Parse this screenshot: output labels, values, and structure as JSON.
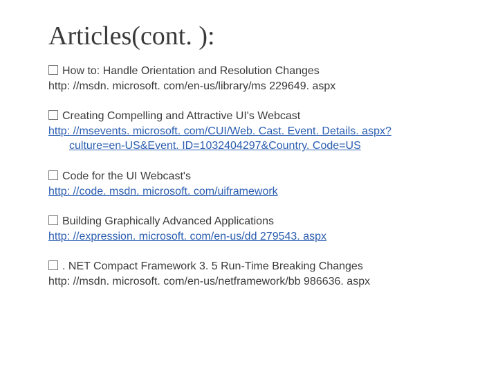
{
  "title": "Articles(cont. ):",
  "items": [
    {
      "heading": "How to: Handle Orientation and Resolution Changes",
      "url": "http: //msdn. microsoft. com/en-us/library/ms 229649. aspx",
      "url_cont": "",
      "is_link": false
    },
    {
      "heading": "Creating Compelling and Attractive UI's Webcast",
      "url": "http: //msevents. microsoft. com/CUI/Web. Cast. Event. Details. aspx?",
      "url_cont": "culture=en-US&Event. ID=1032404297&Country. Code=US",
      "is_link": true
    },
    {
      "heading": "Code for the UI Webcast's",
      "url": "http: //code. msdn. microsoft. com/uiframework",
      "url_cont": "",
      "is_link": true
    },
    {
      "heading": "Building Graphically Advanced Applications",
      "url": "http: //expression. microsoft. com/en-us/dd 279543. aspx",
      "url_cont": "",
      "is_link": true
    },
    {
      "heading": ". NET Compact Framework 3. 5 Run-Time Breaking Changes",
      "url": "http: //msdn. microsoft. com/en-us/netframework/bb 986636. aspx",
      "url_cont": "",
      "is_link": false
    }
  ]
}
